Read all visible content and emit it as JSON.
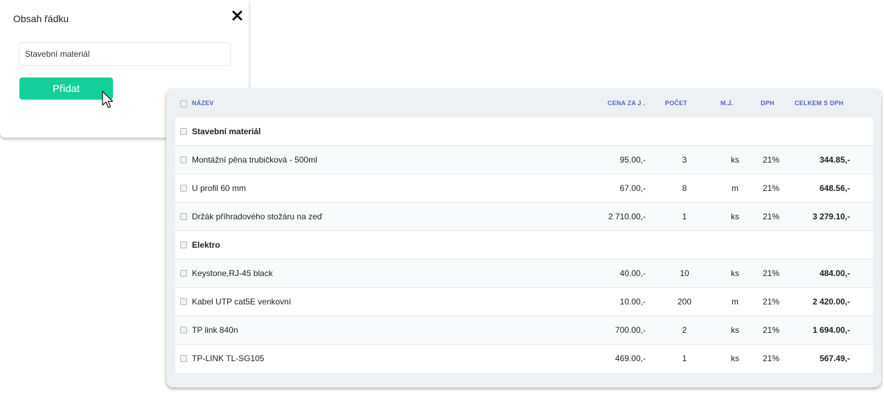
{
  "popup": {
    "title": "Obsah řádku",
    "input_value": "Stavební materiál",
    "button_label": "Přidat",
    "accent_color": "#13cf9a"
  },
  "table": {
    "columns": {
      "name": "NÁZEV",
      "price": "CENA ZA J .",
      "qty": "POČET",
      "unit": "M.J.",
      "vat": "DPH",
      "total": "CELKEM S DPH"
    },
    "header_color": "#5562c7",
    "rows": [
      {
        "type": "group",
        "name": "Stavební materiál"
      },
      {
        "type": "item",
        "name": "Montážní pěna trubičková - 500ml",
        "price": "95.00,-",
        "qty": "3",
        "unit": "ks",
        "vat": "21%",
        "total": "344.85,-"
      },
      {
        "type": "item",
        "name": "U profil 60 mm",
        "price": "67.00,-",
        "qty": "8",
        "unit": "m",
        "vat": "21%",
        "total": "648.56,-"
      },
      {
        "type": "item",
        "name": "Držák příhradového stožáru na zeď",
        "price": "2 710.00,-",
        "qty": "1",
        "unit": "ks",
        "vat": "21%",
        "total": "3 279.10,-"
      },
      {
        "type": "group",
        "name": "Elektro"
      },
      {
        "type": "item",
        "name": "Keystone,RJ-45 black",
        "price": "40.00,-",
        "qty": "10",
        "unit": "ks",
        "vat": "21%",
        "total": "484.00,-"
      },
      {
        "type": "item",
        "name": "Kabel UTP cat5E venkovní",
        "price": "10.00,-",
        "qty": "200",
        "unit": "m",
        "vat": "21%",
        "total": "2 420.00,-"
      },
      {
        "type": "item",
        "name": "TP link 840n",
        "price": "700.00,-",
        "qty": "2",
        "unit": "ks",
        "vat": "21%",
        "total": "1 694.00,-"
      },
      {
        "type": "item",
        "name": "TP-LINK TL-SG105",
        "price": "469.00,-",
        "qty": "1",
        "unit": "ks",
        "vat": "21%",
        "total": "567.49,-"
      }
    ]
  },
  "icons": {
    "close": "close-icon",
    "cursor": "mouse-pointer-icon"
  }
}
